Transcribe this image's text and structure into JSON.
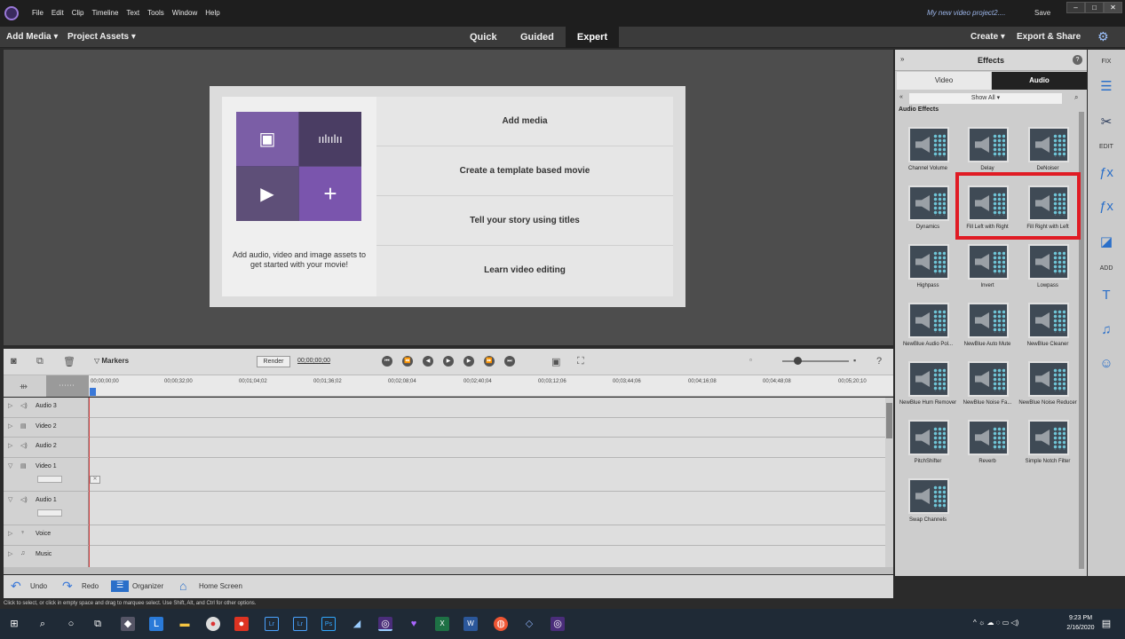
{
  "titlebar": {
    "menu": [
      "File",
      "Edit",
      "Clip",
      "Timeline",
      "Text",
      "Tools",
      "Window",
      "Help"
    ],
    "project": "My new video project2....",
    "save": "Save"
  },
  "toolbar": {
    "add_media": "Add Media ▾",
    "project_assets": "Project Assets ▾",
    "modes": [
      "Quick",
      "Guided",
      "Expert"
    ],
    "active_mode": "Expert",
    "create": "Create ▾",
    "export_share": "Export & Share"
  },
  "welcome": {
    "description": "Add audio, video and image assets to get started with your movie!",
    "options": [
      "Add media",
      "Create a template based movie",
      "Tell your story using titles",
      "Learn video editing"
    ]
  },
  "timeline": {
    "markers": "Markers",
    "render": "Render",
    "timecode": "00;00;00;00",
    "ruler": [
      "00;00;00;00",
      "00;00;32;00",
      "00;01;04;02",
      "00;01;36;02",
      "00;02;08;04",
      "00;02;40;04",
      "00;03;12;06",
      "00;03;44;06",
      "00;04;16;08",
      "00;04;48;08",
      "00;05;20;10"
    ],
    "tracks": [
      "Audio 3",
      "Video 2",
      "Audio 2",
      "Video 1",
      "Audio 1",
      "Voice",
      "Music"
    ]
  },
  "bottombar": {
    "undo": "Undo",
    "redo": "Redo",
    "organizer": "Organizer",
    "home_screen": "Home Screen"
  },
  "status": "Click to select, or click in empty space and drag to marquee select. Use Shift, Alt, and Ctrl for other options.",
  "panel": {
    "title": "Effects",
    "tabs": [
      "Video",
      "Audio"
    ],
    "active_tab": "Audio",
    "filter": "Show All ▾",
    "category": "Audio Effects",
    "effects": [
      "Channel Volume",
      "Delay",
      "DeNoiser",
      "Dynamics",
      "Fill Left with Right",
      "Fill Right with Left",
      "Highpass",
      "Invert",
      "Lowpass",
      "NewBlue Audio Pol...",
      "NewBlue Auto Mute",
      "NewBlue Cleaner",
      "NewBlue Hum Remover",
      "NewBlue Noise Fa...",
      "NewBlue Noise Reducer",
      "PitchShifter",
      "Reverb",
      "Simple Notch Filter",
      "Swap Channels"
    ]
  },
  "sidebar": {
    "fix": "FIX",
    "edit": "EDIT",
    "add": "ADD"
  },
  "taskbar": {
    "time": "9:23 PM",
    "date": "2/16/2020"
  },
  "colors": {
    "highlight": "#e01b24",
    "accent": "#2a6fc9"
  }
}
